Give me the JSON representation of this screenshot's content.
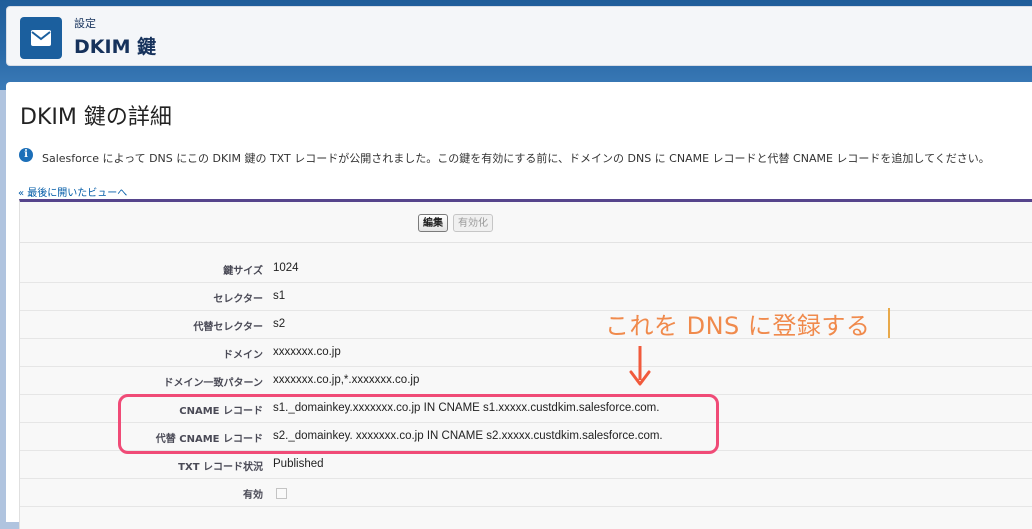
{
  "header": {
    "breadcrumb": "設定",
    "title": "DKIM 鍵",
    "icon": "envelope-icon"
  },
  "page": {
    "title": "DKIM 鍵の詳細",
    "info_message": "Salesforce によって DNS にこの DKIM 鍵の TXT レコードが公開されました。この鍵を有効にする前に、ドメインの DNS に CNAME レコードと代替 CNAME レコードを追加してください。",
    "back_link": "« 最後に開いたビューへ"
  },
  "buttons": {
    "edit": "編集",
    "activate": "有効化"
  },
  "fields": [
    {
      "label": "鍵サイズ",
      "value": "1024"
    },
    {
      "label": "セレクター",
      "value": "s1"
    },
    {
      "label": "代替セレクター",
      "value": "s2"
    },
    {
      "label": "ドメイン",
      "value": "xxxxxxx.co.jp"
    },
    {
      "label": "ドメイン一致パターン",
      "value": "xxxxxxx.co.jp,*.xxxxxxx.co.jp"
    },
    {
      "label": "CNAME レコード",
      "value": "s1._domainkey.xxxxxxx.co.jp IN CNAME s1.xxxxx.custdkim.salesforce.com."
    },
    {
      "label": "代替 CNAME レコード",
      "value": "s2._domainkey. xxxxxxx.co.jp IN CNAME s2.xxxxx.custdkim.salesforce.com."
    },
    {
      "label": "TXT レコード状況",
      "value": "Published"
    },
    {
      "label": "有効",
      "value": ""
    }
  ],
  "annotation": {
    "text": "これを DNS に登録する",
    "color": "#f08a4c",
    "highlight_color": "#f04b77"
  }
}
